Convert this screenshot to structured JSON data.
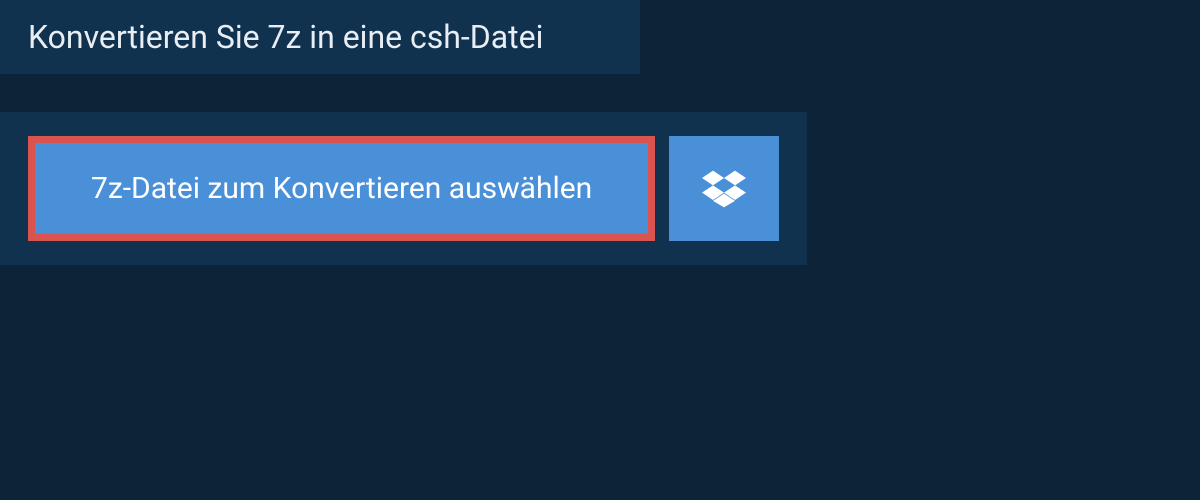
{
  "header": {
    "title": "Konvertieren Sie 7z in eine csh-Datei"
  },
  "upload": {
    "select_button_label": "7z-Datei zum Konvertieren auswählen",
    "dropbox_icon_name": "dropbox"
  },
  "colors": {
    "background": "#0d2438",
    "panel": "#11324f",
    "button": "#4a90d9",
    "highlight_border": "#d9534f",
    "text": "#ffffff"
  }
}
